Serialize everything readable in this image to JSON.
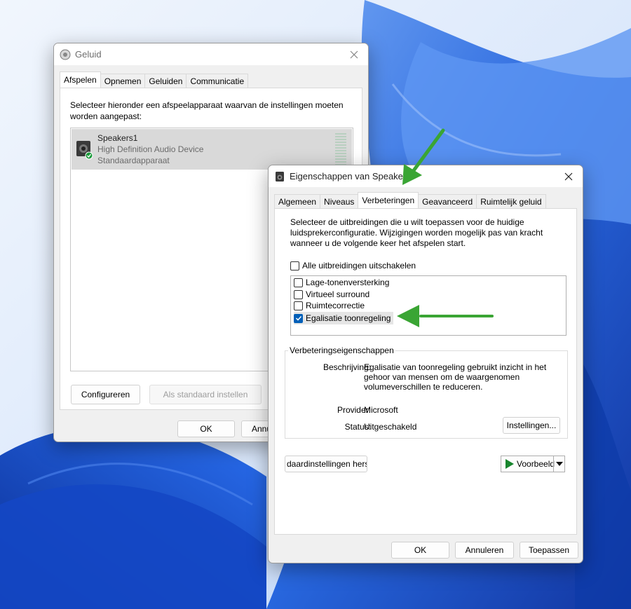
{
  "colors": {
    "accent": "#005fb8",
    "arrow_green": "#3aa534",
    "wallpaper_light": "#e3eefc",
    "wallpaper_blue": "#1d5fd6"
  },
  "sound_window": {
    "title": "Geluid",
    "tabs": [
      "Afspelen",
      "Opnemen",
      "Geluiden",
      "Communicatie"
    ],
    "active_tab": "Afspelen",
    "instruction": "Selecteer hieronder een afspeelapparaat waarvan de instellingen moeten worden aangepast:",
    "device": {
      "name": "Speakers1",
      "description": "High Definition Audio Device",
      "status": "Standaardapparaat"
    },
    "configure_label": "Configureren",
    "set_default_label": "Als standaard instellen",
    "ok_label": "OK",
    "cancel_label": "Annu"
  },
  "props_window": {
    "title": "Eigenschappen van Speake",
    "tabs": [
      "Algemeen",
      "Niveaus",
      "Verbeteringen",
      "Geavanceerd",
      "Ruimtelijk geluid"
    ],
    "active_tab": "Verbeteringen",
    "instruction": "Selecteer de uitbreidingen die u wilt toepassen voor de huidige luidsprekerconfiguratie. Wijzigingen worden mogelijk pas van kracht wanneer u de volgende keer het afspelen start.",
    "disable_all_label": "Alle uitbreidingen uitschakelen",
    "disable_all_checked": false,
    "enhancements": [
      {
        "label": "Lage-tonenversterking",
        "checked": false
      },
      {
        "label": "Virtueel surround",
        "checked": false
      },
      {
        "label": "Ruimtecorrectie",
        "checked": false
      },
      {
        "label": "Egalisatie toonregeling",
        "checked": true
      }
    ],
    "group_title": "Verbeteringseigenschappen",
    "description_label": "Beschrijving:",
    "description_value": "Egalisatie van toonregeling gebruikt inzicht in het gehoor van mensen om de waargenomen volumeverschillen te reduceren.",
    "provider_label": "Provider:",
    "provider_value": "Microsoft",
    "status_label": "Status:",
    "status_value": "Uitgeschakeld",
    "settings_button": "Instellingen...",
    "restore_button": "daardinstellingen herst",
    "preview_button": "Voorbeeld",
    "ok_label": "OK",
    "cancel_label": "Annuleren",
    "apply_label": "Toepassen"
  }
}
